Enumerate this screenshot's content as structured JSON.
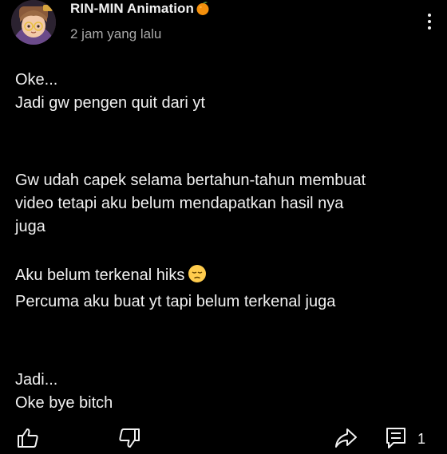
{
  "header": {
    "channel_name": "RIN-MIN Animation",
    "timestamp": "2 jam yang lalu"
  },
  "comment": {
    "paragraphs": [
      [
        "Oke...",
        "Jadi gw pengen quit dari yt"
      ],
      [
        "Gw udah capek selama bertahun-tahun membuat",
        "video tetapi aku belum mendapatkan hasil nya",
        "juga"
      ],
      [
        "Aku belum terkenal hiks",
        "Percuma aku buat yt tapi belum terkenal juga"
      ],
      [
        "Jadi...",
        "Oke bye bitch"
      ]
    ]
  },
  "actions": {
    "reply_count": "1"
  },
  "icons": {
    "avatar": "avatar",
    "orange_emoji": "tangerine-emoji-icon",
    "sad_emoji": "pensive-face-emoji-icon",
    "more": "more-vert-icon",
    "like": "thumbs-up-icon",
    "dislike": "thumbs-down-icon",
    "share": "share-icon",
    "reply": "comment-icon"
  },
  "colors": {
    "background": "#000000",
    "text": "#f1f1f1",
    "muted": "#aaaaaa",
    "emoji_orange": "#f4900c"
  }
}
